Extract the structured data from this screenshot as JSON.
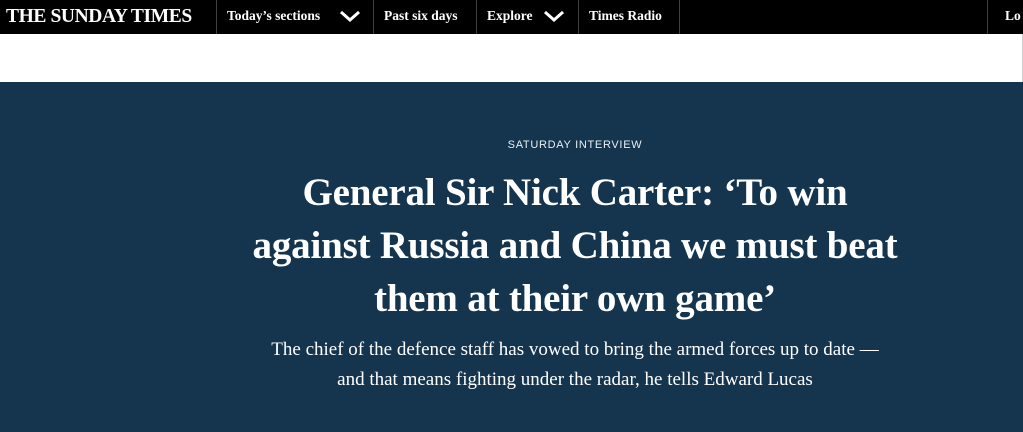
{
  "nav": {
    "logo": "THE SUNDAY TIMES",
    "items": [
      {
        "label": "Today’s sections",
        "icon": "chevron-down-icon"
      },
      {
        "label": "Past six days"
      },
      {
        "label": "Explore",
        "icon": "chevron-down-icon"
      },
      {
        "label": "Times Radio"
      }
    ],
    "login_label": "Lo"
  },
  "article": {
    "kicker": "SATURDAY INTERVIEW",
    "headline": "General Sir Nick Carter: ‘To win against Russia and China we must beat them at their own game’",
    "standfirst": "The chief of the defence staff has vowed to bring the armed forces up to date — and that means fighting under the radar, he tells Edward Lucas"
  },
  "colors": {
    "nav_background": "#000000",
    "hero_background": "#15354e",
    "text_on_dark": "#ffffff"
  }
}
